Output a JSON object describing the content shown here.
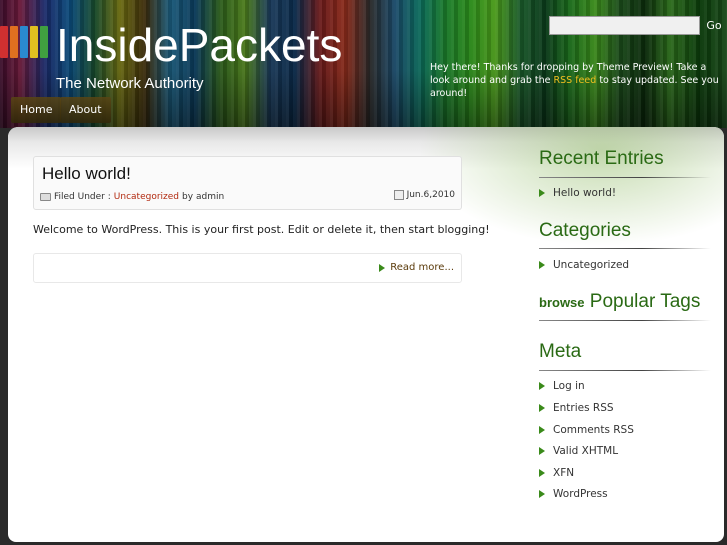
{
  "header": {
    "site_title": "InsidePackets",
    "tagline": "The Network Authority",
    "logo_colors": [
      "#d03030",
      "#e07020",
      "#2a8ad0",
      "#e0c020",
      "#40a040"
    ],
    "search": {
      "value": "",
      "placeholder": "",
      "button_label": "Go"
    },
    "welcome": {
      "before_link": "Hey there! Thanks for dropping by Theme Preview! Take a look around and grab the",
      "link": "RSS feed",
      "after_link": "to stay updated. See you around!"
    }
  },
  "nav": {
    "items": [
      "Home",
      "About"
    ]
  },
  "post": {
    "title": "Hello world!",
    "filed_under_label": "Filed Under :",
    "category": "Uncategorized",
    "by_label": "by",
    "author": "admin",
    "date": "Jun.6,2010",
    "body": "Welcome to WordPress. This is your first post. Edit or delete it, then start blogging!",
    "read_more": "Read more..."
  },
  "sidebar": {
    "recent_title": "Recent Entries",
    "recent_items": [
      "Hello world!"
    ],
    "categories_title": "Categories",
    "categories_items": [
      "Uncategorized"
    ],
    "tags_prefix": "browse",
    "tags_title": "Popular Tags",
    "meta_title": "Meta",
    "meta_items": [
      "Log in",
      "Entries RSS",
      "Comments RSS",
      "Valid XHTML",
      "XFN",
      "WordPress"
    ]
  },
  "colors": {
    "accent_green": "#2a6a14",
    "category_link": "#b22a10",
    "rss_link": "#f2c020"
  },
  "icons": {
    "bullet": "green-arrow-icon",
    "filed": "folder-icon",
    "date": "calendar-icon"
  }
}
